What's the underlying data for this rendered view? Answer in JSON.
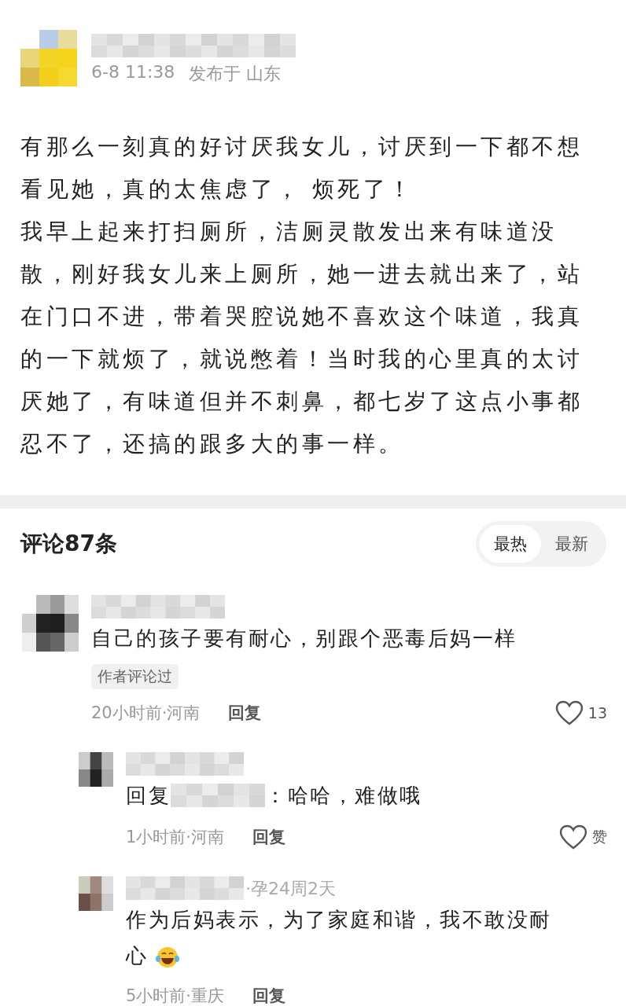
{
  "post": {
    "time": "6-8 11:38",
    "location": "发布于 山东",
    "paragraphs": [
      "有那么一刻真的好讨厌我女儿，讨厌到一下都不想看见她，真的太焦虑了， 烦死了！",
      "我早上起来打扫厕所，洁厕灵散发出来有味道没散，刚好我女儿来上厕所，她一进去就出来了，站在门口不进，带着哭腔说她不喜欢这个味道，我真的一下就烦了，就说憋着！当时我的心里真的太讨厌她了，有味道但并不刺鼻，都七岁了这点小事都忍不了，还搞的跟多大的事一样。"
    ]
  },
  "comments_header": {
    "title": "评论87条",
    "sort_tabs": [
      {
        "label": "最热",
        "selected": true
      },
      {
        "label": "最新",
        "selected": false
      }
    ]
  },
  "comments": [
    {
      "text": "自己的孩子要有耐心，别跟个恶毒后妈一样",
      "tag": "作者评论过",
      "time_location": "20小时前·河南",
      "reply_label": "回复",
      "likes": "13",
      "replies": [
        {
          "prefix": "回复",
          "text": "：哈哈，难做哦",
          "time_location": "1小时前·河南",
          "reply_label": "回复",
          "likes": "赞"
        },
        {
          "badge": "·孕24周2天",
          "text": "作为后妈表示，为了家庭和谐，我不敢没耐心",
          "emoji": true,
          "time_location": "5小时前·重庆",
          "reply_label": "回复"
        }
      ]
    }
  ]
}
